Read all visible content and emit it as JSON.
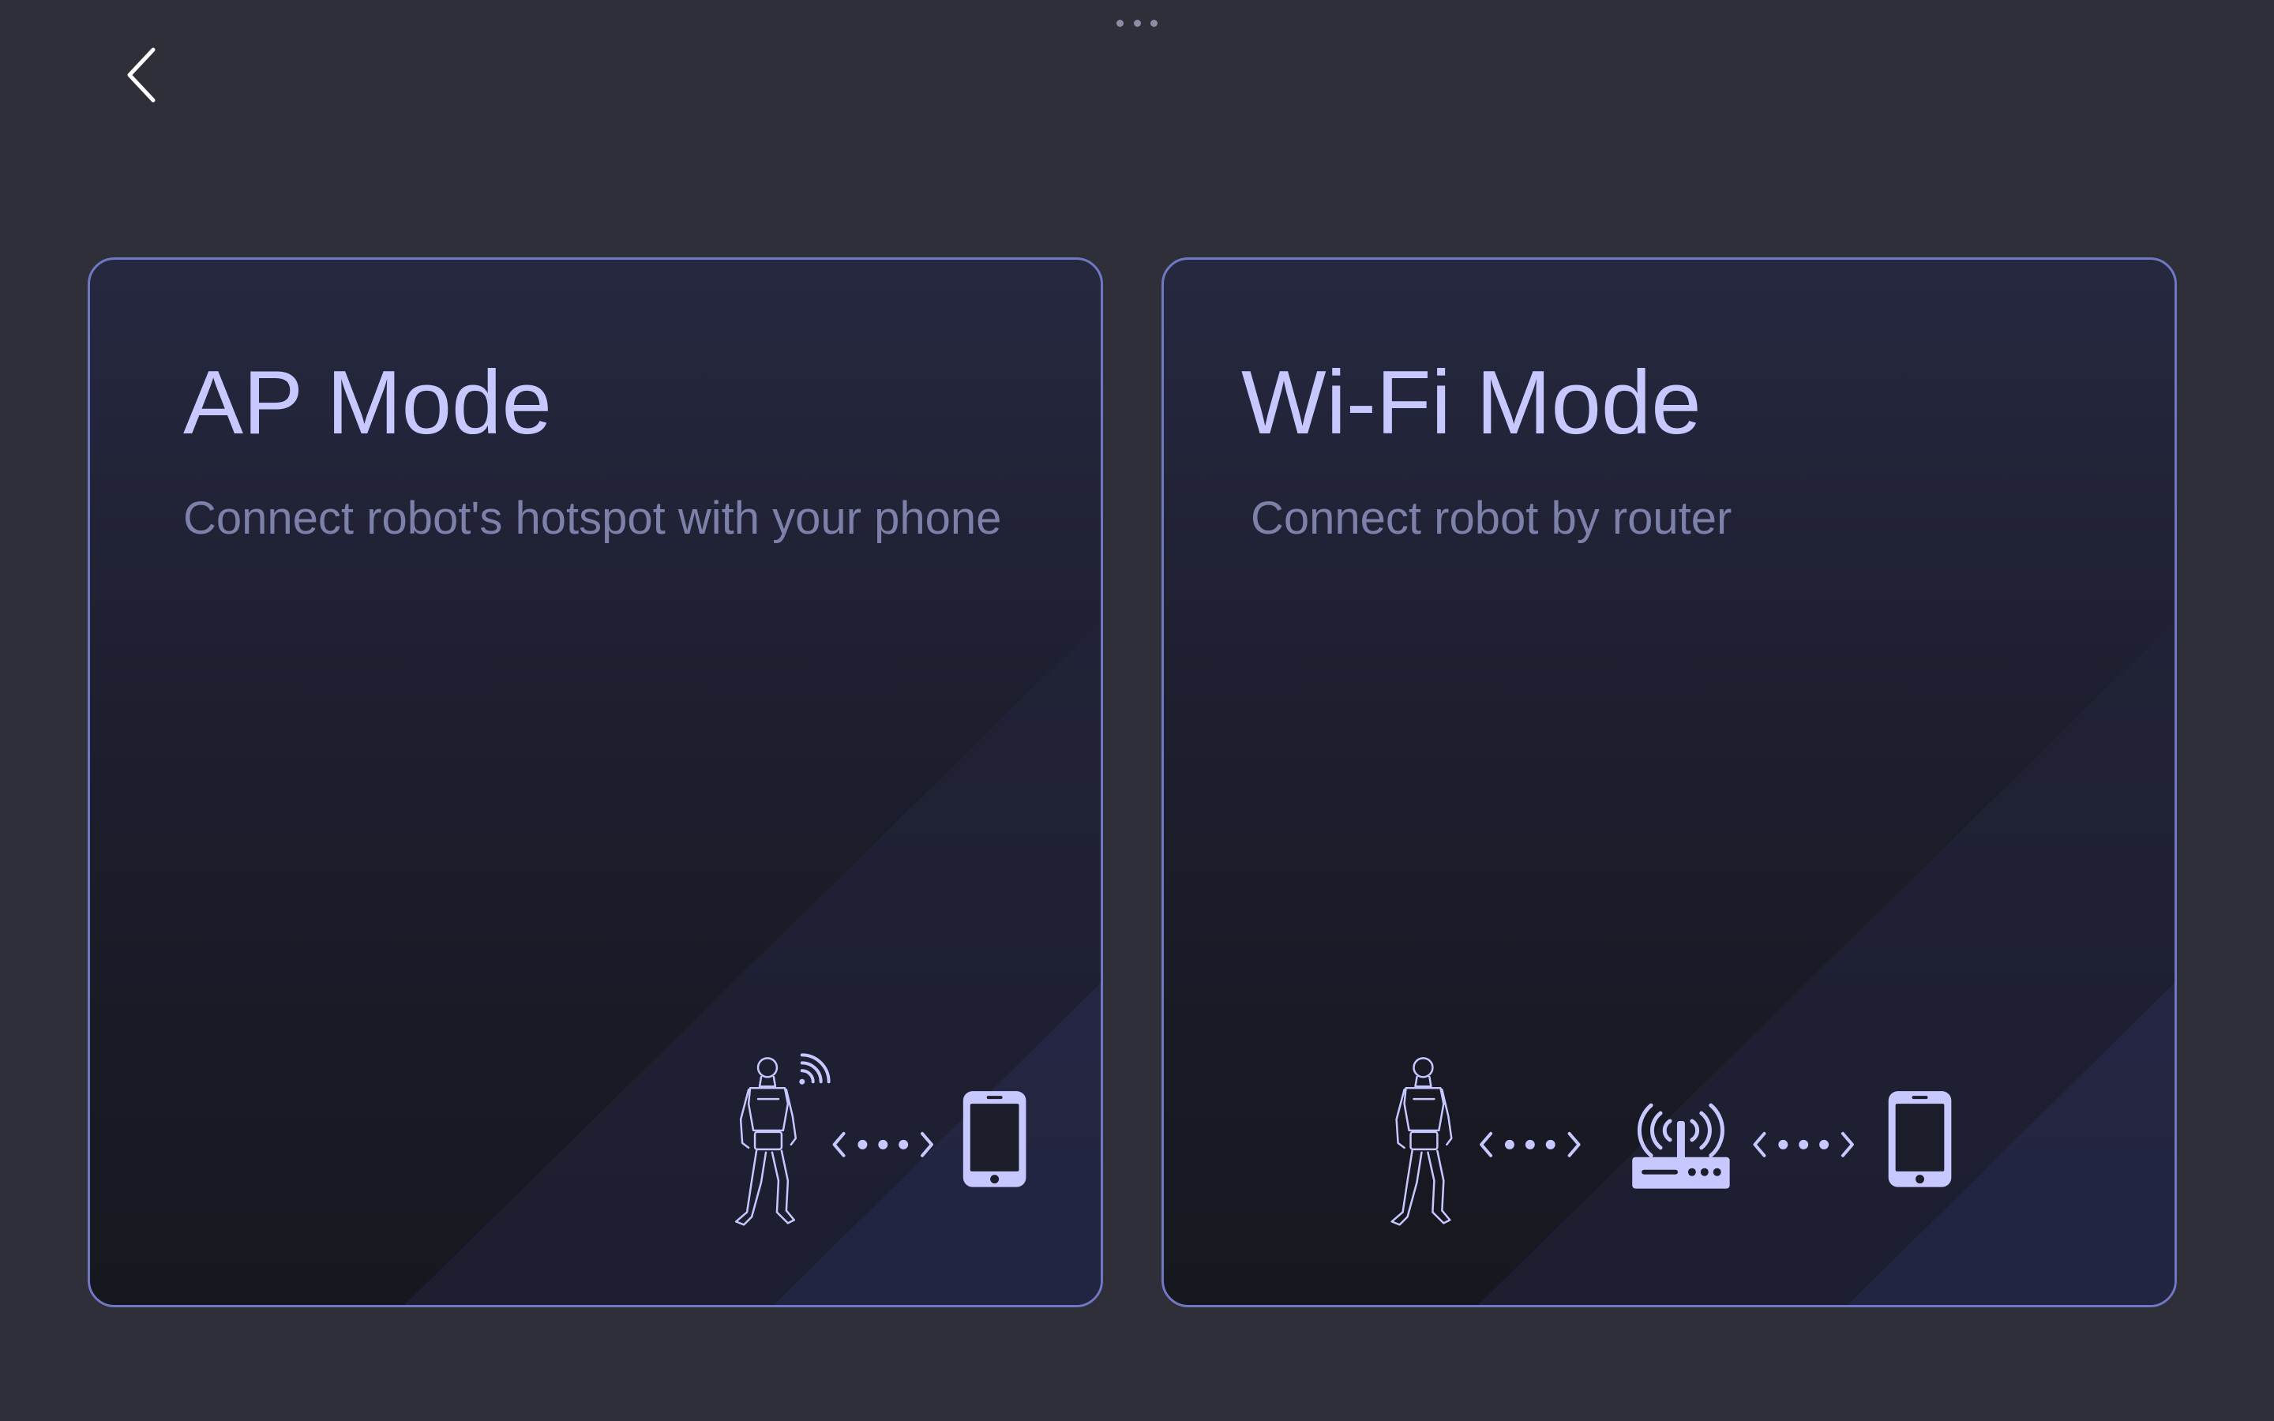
{
  "header": {
    "back_icon": "chevron-left-icon",
    "more_icon": "more-horizontal-icon"
  },
  "cards": {
    "ap": {
      "title": "AP Mode",
      "description": "Connect robot's hotspot with your phone",
      "icons": [
        "robot-icon",
        "wireless-signal-icon",
        "dotted-link-icon",
        "phone-icon"
      ]
    },
    "wifi": {
      "title": "Wi-Fi Mode",
      "description": "Connect robot by router",
      "icons": [
        "robot-icon",
        "dotted-link-icon",
        "router-icon",
        "dotted-link-icon",
        "phone-icon"
      ]
    }
  },
  "colors": {
    "background": "#2f2f3a",
    "card_border": "#6f78c2",
    "title": "#c6c8ff",
    "description": "#7d80a9",
    "icon": "#c6c8ff"
  }
}
